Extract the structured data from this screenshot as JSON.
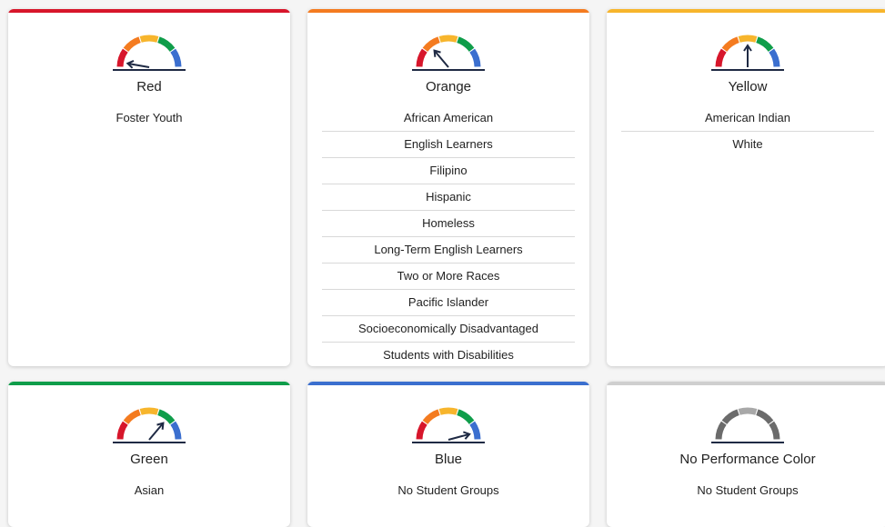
{
  "cards": [
    {
      "label": "Red",
      "accent": "#d7162b",
      "gauge_needle": "red",
      "groups": [
        "Foster Youth"
      ]
    },
    {
      "label": "Orange",
      "accent": "#f47b20",
      "gauge_needle": "orange",
      "groups": [
        "African American",
        "English Learners",
        "Filipino",
        "Hispanic",
        "Homeless",
        "Long-Term English Learners",
        "Two or More Races",
        "Pacific Islander",
        "Socioeconomically Disadvantaged",
        "Students with Disabilities"
      ]
    },
    {
      "label": "Yellow",
      "accent": "#f7b52c",
      "gauge_needle": "yellow",
      "groups": [
        "American Indian",
        "White"
      ]
    },
    {
      "label": "Green",
      "accent": "#0f9d4a",
      "gauge_needle": "green",
      "groups": [
        "Asian"
      ]
    },
    {
      "label": "Blue",
      "accent": "#3b6fcf",
      "gauge_needle": "blue",
      "groups": [
        "No Student Groups"
      ]
    },
    {
      "label": "No Performance Color",
      "accent": "#cfcfcf",
      "gauge_needle": "none",
      "groups": [
        "No Student Groups"
      ]
    }
  ],
  "gauge_colors": {
    "red": "#d7162b",
    "orange": "#f47b20",
    "yellow": "#f7b52c",
    "green": "#0f9d4a",
    "blue": "#3b6fcf",
    "gray_dark": "#6b6b6b",
    "gray_light": "#a8a8a8",
    "needle": "#1f2a44"
  }
}
